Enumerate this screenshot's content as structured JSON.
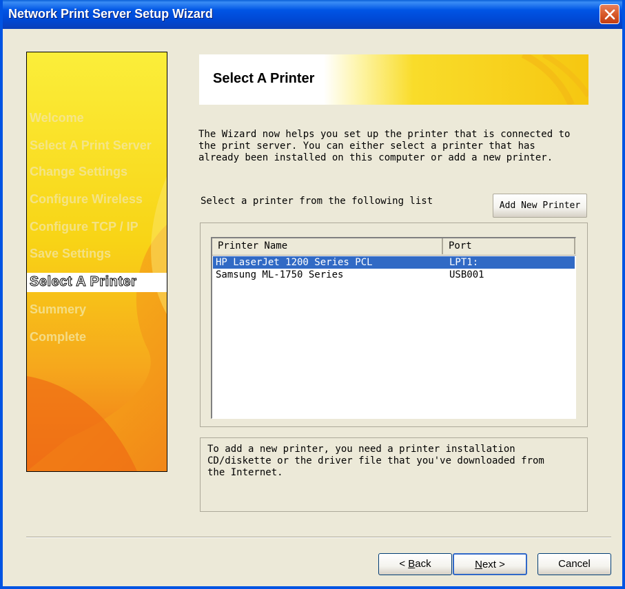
{
  "window": {
    "title": "Network Print Server Setup Wizard"
  },
  "sidebar": {
    "items": [
      {
        "label": "Welcome"
      },
      {
        "label": "Select A Print Server"
      },
      {
        "label": "Change Settings"
      },
      {
        "label": "Configure Wireless"
      },
      {
        "label": "Configure  TCP / IP"
      },
      {
        "label": "Save Settings"
      },
      {
        "label": "Select A Printer"
      },
      {
        "label": "Summery"
      },
      {
        "label": "Complete"
      }
    ],
    "current_index": 6
  },
  "banner": {
    "title": "Select A Printer"
  },
  "intro_text": "The Wizard now helps you set up the printer that is connected to\nthe print server. You can either select a printer that has\nalready been installed on this computer or add a new printer.",
  "select_label": "Select a printer from the following list",
  "add_button": "Add New Printer",
  "printer_list": {
    "columns": [
      "Printer Name",
      "Port"
    ],
    "rows": [
      {
        "name": "HP LaserJet 1200 Series PCL",
        "port": "LPT1:",
        "selected": true
      },
      {
        "name": "Samsung ML-1750 Series",
        "port": "USB001",
        "selected": false
      }
    ]
  },
  "info_text": "To add a new printer, you need a printer installation\nCD/diskette or the driver file that you've downloaded from\nthe Internet.",
  "buttons": {
    "back_prefix": "< ",
    "back_mnemonic": "B",
    "back_rest": "ack",
    "next_mnemonic": "N",
    "next_rest": "ext >",
    "cancel": "Cancel"
  },
  "colors": {
    "titlebar": "#0055e5",
    "selection": "#316ac5",
    "accent_yellow": "#f7d10a",
    "accent_orange": "#f07a12"
  },
  "icons": {
    "close": "close-icon"
  }
}
